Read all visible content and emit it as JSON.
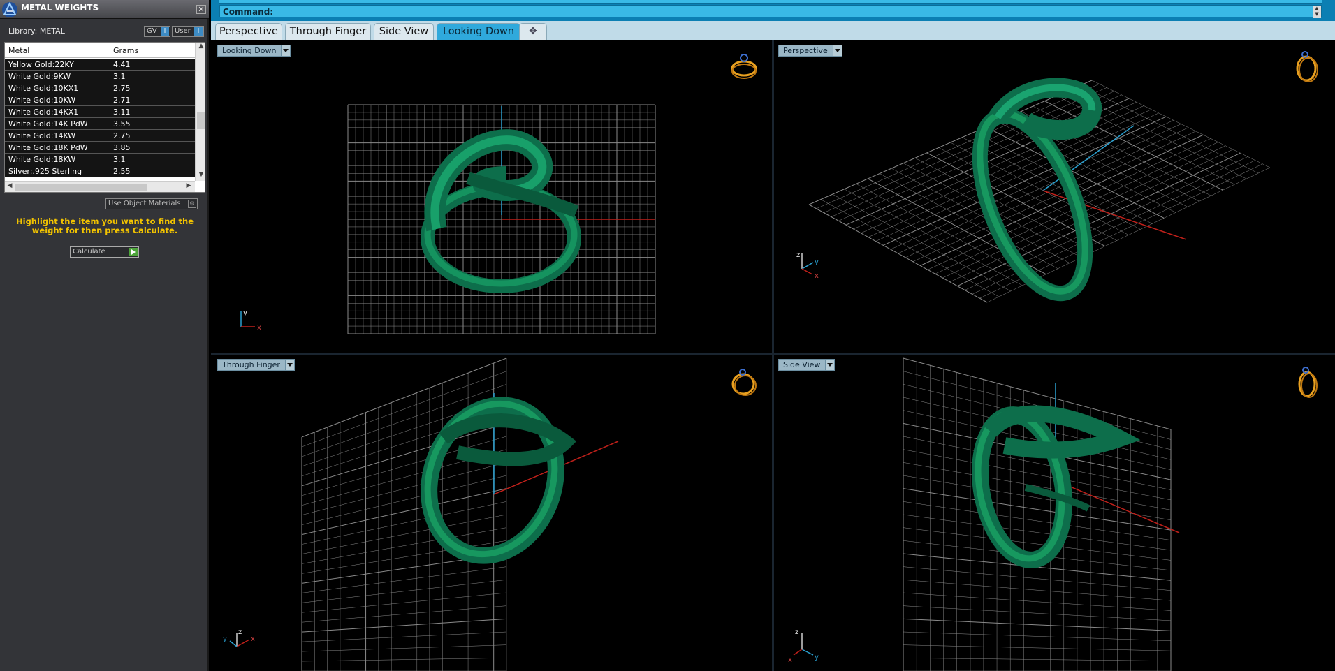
{
  "panel": {
    "title": "METAL WEIGHTS",
    "close_glyph": "✕",
    "library_label": "Library: METAL",
    "gv_label": "GV",
    "user_label": "User",
    "table": {
      "col_metal": "Metal",
      "col_grams": "Grams",
      "rows": [
        {
          "metal": "Yellow Gold:22KY",
          "grams": "4.41"
        },
        {
          "metal": "White Gold:9KW",
          "grams": "3.1"
        },
        {
          "metal": "White Gold:10KX1",
          "grams": "2.75"
        },
        {
          "metal": "White Gold:10KW",
          "grams": "2.71"
        },
        {
          "metal": "White Gold:14KX1",
          "grams": "3.11"
        },
        {
          "metal": "White Gold:14K PdW",
          "grams": "3.55"
        },
        {
          "metal": "White Gold:14KW",
          "grams": "2.75"
        },
        {
          "metal": "White Gold:18K PdW",
          "grams": "3.85"
        },
        {
          "metal": "White Gold:18KW",
          "grams": "3.1"
        },
        {
          "metal": "Silver:.925 Sterling",
          "grams": "2.55"
        }
      ]
    },
    "use_object_materials": "Use Object Materials",
    "hint": "Highlight the item you want to find the weight for then press Calculate.",
    "calculate_label": "Calculate"
  },
  "command": {
    "label": "Command:"
  },
  "tabs": [
    {
      "label": "Perspective",
      "active": false
    },
    {
      "label": "Through Finger",
      "active": false
    },
    {
      "label": "Side View",
      "active": false
    },
    {
      "label": "Looking Down",
      "active": true
    }
  ],
  "tab_add_glyph": "✥",
  "viewports": {
    "top_left": {
      "label": "Looking Down"
    },
    "top_right": {
      "label": "Perspective"
    },
    "bottom_left": {
      "label": "Through Finger"
    },
    "bottom_right": {
      "label": "Side View"
    }
  },
  "axes": {
    "looking_down": {
      "v": "y",
      "h": "x"
    },
    "perspective": {
      "a": "z",
      "b": "y",
      "c": "x"
    },
    "through_finger": {
      "a": "y",
      "b": "z",
      "c": "x"
    },
    "side_view": {
      "a": "z",
      "b": "x",
      "c": "y"
    }
  },
  "colors": {
    "ring": "#0e7a52",
    "grid": "#8a8a8a",
    "axis_red": "#c0201a",
    "axis_blue": "#2aa0d0",
    "hint": "#f2c300"
  }
}
